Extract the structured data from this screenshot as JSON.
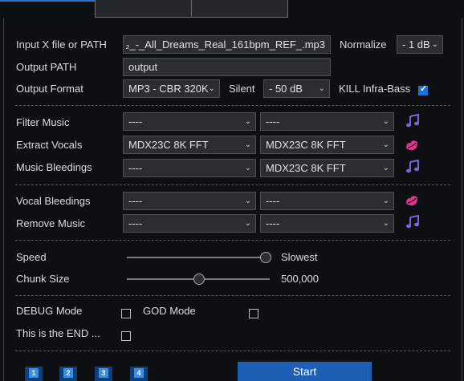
{
  "labels": {
    "input": "Input X file or PATH",
    "output_path": "Output PATH",
    "output_format": "Output Format",
    "normalize": "Normalize",
    "silent": "Silent",
    "kill": "KILL Infra-Bass",
    "filter_music": "Filter Music",
    "extract_vocals": "Extract Vocals",
    "music_bleedings": "Music Bleedings",
    "vocal_bleedings": "Vocal Bleedings",
    "remove_music": "Remove Music",
    "speed": "Speed",
    "chunk_size": "Chunk Size",
    "debug": "DEBUG Mode",
    "god": "GOD Mode",
    "end": "This is the END ..."
  },
  "values": {
    "input_file": "₂_-_All_Dreams_Real_161bpm_REF_.mp3",
    "output_path": "output",
    "output_format": "MP3 - CBR 320K",
    "normalize": "- 1 dB",
    "silent": "- 50 dB",
    "kill_checked": true,
    "speed": "Slowest",
    "speed_level": 1.0,
    "chunk_size": "500,000",
    "chunk_level": 0.5,
    "debug_checked": false,
    "god_checked": false,
    "end_checked": false
  },
  "models": {
    "filter_music": [
      "----",
      "----"
    ],
    "extract_vocals": [
      "MDX23C 8K FFT",
      "MDX23C 8K FFT"
    ],
    "music_bleedings": [
      "----",
      "MDX23C 8K FFT"
    ],
    "vocal_bleedings": [
      "----",
      "----"
    ],
    "remove_music": [
      "----",
      "----"
    ]
  },
  "buttons": {
    "num1": "1",
    "num2": "2",
    "num3": "3",
    "num4": "4",
    "start": "Start"
  },
  "icons": {
    "music": "music-note-icon",
    "lips": "lips-icon"
  },
  "colors": {
    "accent": "#1c5fb5",
    "music_icon": "#7a66d8",
    "lips_icon": "#e0358a"
  }
}
